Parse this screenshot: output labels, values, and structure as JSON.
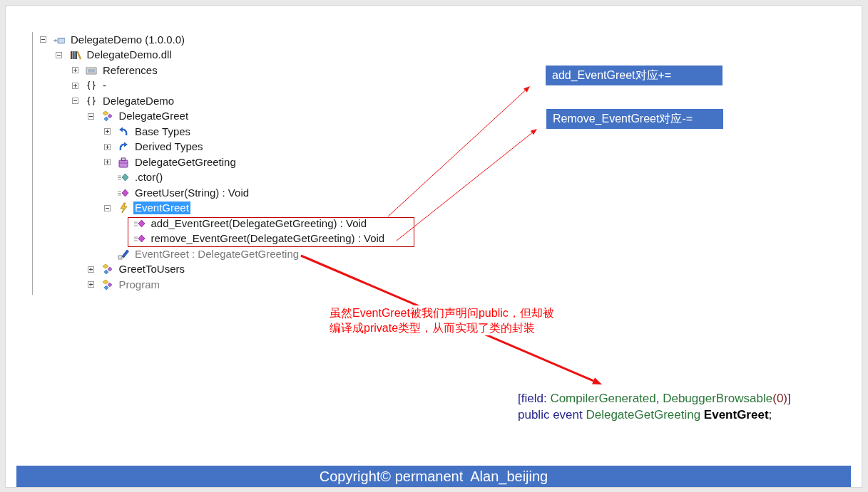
{
  "tree": [
    {
      "label": "DelegateDemo (1.0.0.0)",
      "kind": "assembly",
      "expanded": true,
      "selected": false,
      "dimmed": false,
      "children": [
        {
          "label": "DelegateDemo.dll",
          "kind": "module",
          "expanded": true,
          "selected": false,
          "dimmed": false,
          "children": [
            {
              "label": "References",
              "kind": "references",
              "expanded": false,
              "selected": false,
              "dimmed": false
            },
            {
              "label": "-",
              "kind": "namespace",
              "expanded": false,
              "selected": false,
              "dimmed": false
            },
            {
              "label": "DelegateDemo",
              "kind": "namespace",
              "expanded": true,
              "selected": false,
              "dimmed": false,
              "children": [
                {
                  "label": "DelegateGreet",
                  "kind": "class",
                  "expanded": true,
                  "selected": false,
                  "dimmed": false,
                  "children": [
                    {
                      "label": "Base Types",
                      "kind": "base-types",
                      "expanded": false,
                      "selected": false,
                      "dimmed": false
                    },
                    {
                      "label": "Derived Types",
                      "kind": "derived-types",
                      "expanded": false,
                      "selected": false,
                      "dimmed": false
                    },
                    {
                      "label": "DelegateGetGreeting",
                      "kind": "delegate",
                      "expanded": false,
                      "selected": false,
                      "dimmed": false
                    },
                    {
                      "label": ".ctor()",
                      "kind": "constructor",
                      "selected": false,
                      "dimmed": false
                    },
                    {
                      "label": "GreetUser(String) : Void",
                      "kind": "method",
                      "selected": false,
                      "dimmed": false
                    },
                    {
                      "label": "EventGreet",
                      "kind": "event",
                      "expanded": true,
                      "selected": true,
                      "dimmed": false,
                      "children": [
                        {
                          "label": "add_EventGreet(DelegateGetGreeting) : Void",
                          "kind": "method",
                          "selected": false,
                          "dimmed": false
                        },
                        {
                          "label": "remove_EventGreet(DelegateGetGreeting) : Void",
                          "kind": "method",
                          "selected": false,
                          "dimmed": false
                        }
                      ]
                    },
                    {
                      "label": "EventGreet : DelegateGetGreeting",
                      "kind": "field",
                      "selected": false,
                      "dimmed": true
                    }
                  ]
                },
                {
                  "label": "GreetToUsers",
                  "kind": "class",
                  "expanded": false,
                  "selected": false,
                  "dimmed": false
                },
                {
                  "label": "Program",
                  "kind": "class",
                  "expanded": false,
                  "selected": false,
                  "dimmed": true
                }
              ]
            }
          ]
        }
      ]
    }
  ],
  "callouts": [
    "add_EventGreet对应+=",
    "Remove_EventGreet对应-="
  ],
  "note_lines": [
    "虽然EventGreet被我们声明问public，但却被",
    "编译成private类型，从而实现了类的封装"
  ],
  "code_lines": [
    [
      {
        "kind": "punct",
        "text": "["
      },
      {
        "kind": "keyword",
        "text": "field:"
      },
      {
        "kind": "type",
        "text": " CompilerGenerated"
      },
      {
        "kind": "punct",
        "text": ", "
      },
      {
        "kind": "type",
        "text": "DebuggerBrowsable"
      },
      {
        "kind": "number",
        "text": "(0)"
      },
      {
        "kind": "punct",
        "text": "]"
      }
    ],
    [
      {
        "kind": "keyword",
        "text": "public event "
      },
      {
        "kind": "type",
        "text": "DelegateGetGreeting "
      },
      {
        "kind": "name",
        "text": "EventGreet"
      },
      {
        "kind": "plain",
        "text": ";"
      }
    ]
  ],
  "footer": "Copyright© permanent  Alan_beijing"
}
